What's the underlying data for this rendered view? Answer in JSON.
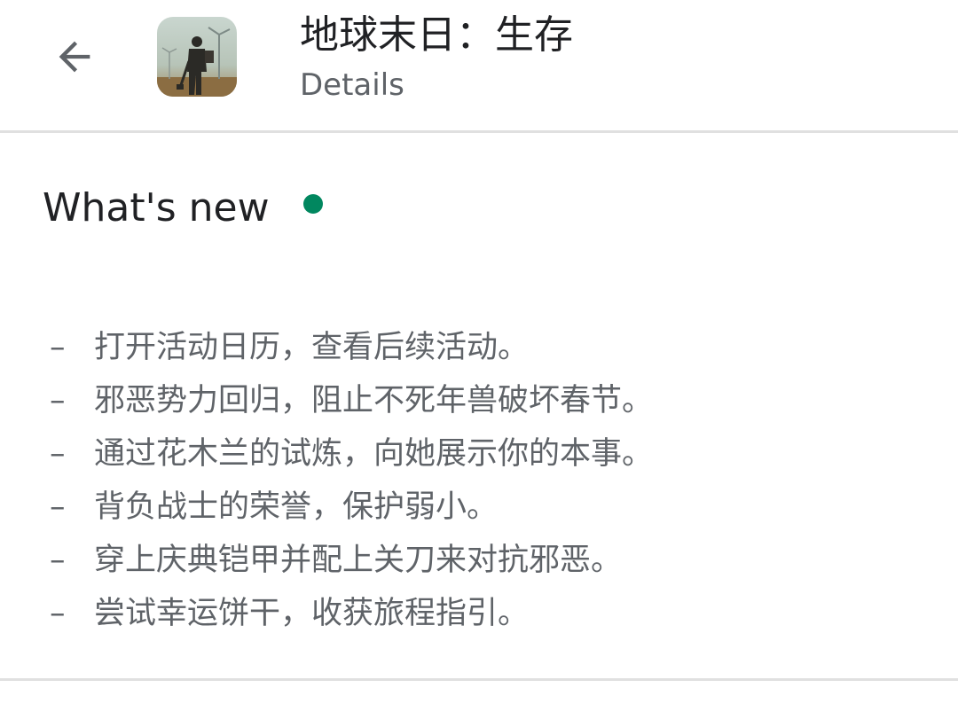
{
  "header": {
    "back_icon": "arrow-back-icon",
    "app_icon": "game-app-icon",
    "app_title": "地球末日：生存",
    "subtitle": "Details"
  },
  "whats_new": {
    "title": "What's new",
    "indicator_color": "#01875f",
    "items": [
      "打开活动日历，查看后续活动。",
      "邪恶势力回归，阻止不死年兽破坏春节。",
      "通过花木兰的试炼，向她展示你的本事。",
      "背负战士的荣誉，保护弱小。",
      "穿上庆典铠甲并配上关刀来对抗邪恶。",
      "尝试幸运饼干，收获旅程指引。"
    ],
    "bullet": "–"
  }
}
